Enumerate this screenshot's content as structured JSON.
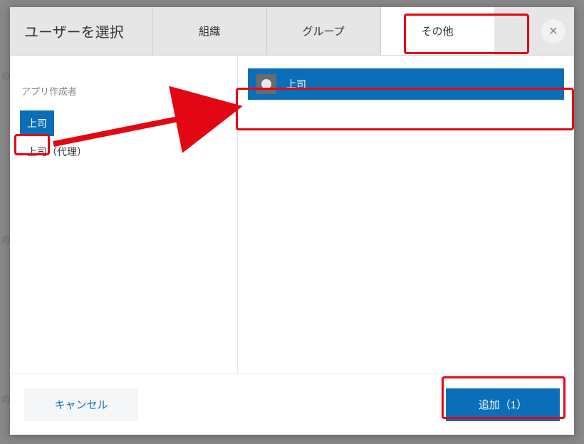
{
  "header": {
    "title": "ユーザーを選択"
  },
  "tabs": [
    {
      "label": "組織"
    },
    {
      "label": "グループ"
    },
    {
      "label": "その他"
    }
  ],
  "sidebar": {
    "section_label": "アプリ作成者",
    "items": [
      {
        "label": "上司"
      },
      {
        "label": "上司（代理）"
      }
    ]
  },
  "main": {
    "selected_item": {
      "label": "上司"
    }
  },
  "footer": {
    "cancel_label": "キャンセル",
    "add_label": "追加（1）"
  },
  "background_hints": [
    "の",
    "の",
    "の"
  ]
}
